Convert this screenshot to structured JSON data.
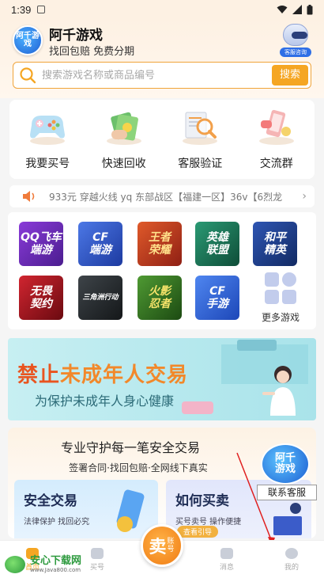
{
  "status_bar": {
    "time": "1:39"
  },
  "header": {
    "logo_text": "阿千游戏",
    "app_name": "阿千游戏",
    "slogan": "找回包赔 免费分期",
    "cs_label": "客服咨询"
  },
  "search": {
    "placeholder": "搜索游戏名称或商品编号",
    "button_label": "搜索"
  },
  "quick_actions": [
    {
      "label": "我要买号",
      "icon": "gamepad-icon"
    },
    {
      "label": "快速回收",
      "icon": "money-icon"
    },
    {
      "label": "客服验证",
      "icon": "magnifier-doc-icon"
    },
    {
      "label": "交流群",
      "icon": "chat-phone-icon"
    }
  ],
  "notice": {
    "text": "933元 穿越火线 yq 东部战区【福建一区】36v【6烈龙"
  },
  "games": [
    {
      "label": "QQ飞车\n端游",
      "color": "#6b2fb8"
    },
    {
      "label": "CF\n端游",
      "color": "#2e56c9"
    },
    {
      "label": "王者\n荣耀",
      "color": "#c23a1f"
    },
    {
      "label": "英雄\n联盟",
      "color": "#1c7a5c"
    },
    {
      "label": "和平\n精英",
      "color": "#1d3d8c"
    },
    {
      "label": "无畏\n契约",
      "color": "#a8141b"
    },
    {
      "label": "三角洲行动",
      "color": "#2b2f33"
    },
    {
      "label": "火影\n忍者",
      "color": "#2e6a1f"
    },
    {
      "label": "CF\n手游",
      "color": "#2a5bd8"
    }
  ],
  "more_games_label": "更多游戏",
  "banner": {
    "title_hl": "禁止",
    "title_rest": "未成年人交易",
    "subtitle": "为保护未成年人身心健康"
  },
  "safety": {
    "title": "专业守护每一笔安全交易",
    "subtitle": "签署合同·找回包赔·全网线下真实",
    "card1_title": "安全交易",
    "card1_text": "法律保护 找回必究",
    "card2_title": "如何买卖",
    "card2_text": "买号卖号 操作便捷",
    "card2_tag": "查看引导",
    "mascot_text": "阿千\n游戏",
    "contact_label": "联系客服"
  },
  "tabbar": {
    "tabs": [
      {
        "label": "首页"
      },
      {
        "label": "买号"
      },
      {
        "label": ""
      },
      {
        "label": "消息"
      },
      {
        "label": "我的"
      }
    ],
    "sell_big": "卖",
    "sell_small": "账号"
  },
  "watermark": {
    "name": "安心下载网",
    "url": "www.Java800.com"
  },
  "colors": {
    "accent": "#f5a623",
    "brand_blue": "#1e5fd4",
    "annotation_red": "#e02020"
  }
}
